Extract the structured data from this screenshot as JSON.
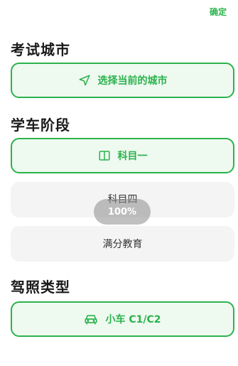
{
  "header": {
    "confirm_label": "确定"
  },
  "sections": {
    "city": {
      "title": "考试城市",
      "button_label": "选择当前的城市",
      "icon": "navigation-arrow-icon"
    },
    "stage": {
      "title": "学车阶段",
      "options": [
        {
          "label": "科目一",
          "selected": true,
          "icon": "book-icon"
        },
        {
          "label": "科目四",
          "selected": false
        },
        {
          "label": "满分教育",
          "selected": false
        }
      ]
    },
    "license": {
      "title": "驾照类型",
      "selected_label": "小车 C1/C2",
      "icon": "car-icon"
    }
  },
  "toast": {
    "text": "100%"
  },
  "colors": {
    "accent": "#2bb24c",
    "selected_bg": "#eef9f0",
    "plain_bg": "#f4f4f4"
  }
}
